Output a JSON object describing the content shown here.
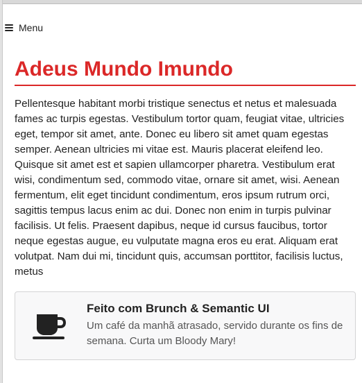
{
  "menu": {
    "label": "Menu"
  },
  "page": {
    "title": "Adeus Mundo Imundo",
    "body": "Pellentesque habitant morbi tristique senectus et netus et malesuada fames ac turpis egestas. Vestibulum tortor quam, feugiat vitae, ultricies eget, tempor sit amet, ante. Donec eu libero sit amet quam egestas semper. Aenean ultricies mi vitae est. Mauris placerat eleifend leo. Quisque sit amet est et sapien ullamcorper pharetra. Vestibulum erat wisi, condimentum sed, commodo vitae, ornare sit amet, wisi. Aenean fermentum, elit eget tincidunt condimentum, eros ipsum rutrum orci, sagittis tempus lacus enim ac dui. Donec non enim in turpis pulvinar facilisis. Ut felis. Praesent dapibus, neque id cursus faucibus, tortor neque egestas augue, eu vulputate magna eros eu erat. Aliquam erat volutpat. Nam dui mi, tincidunt quis, accumsan porttitor, facilisis luctus, metus"
  },
  "footer": {
    "icon": "coffee-cup-icon",
    "header": "Feito com Brunch & Semantic UI",
    "description": "Um café da manhã atrasado, servido durante os fins de semana. Curta um Bloody Mary!"
  },
  "colors": {
    "accent": "#db2828",
    "card_bg": "#f8f8f9",
    "card_border": "#d4d4d5"
  }
}
